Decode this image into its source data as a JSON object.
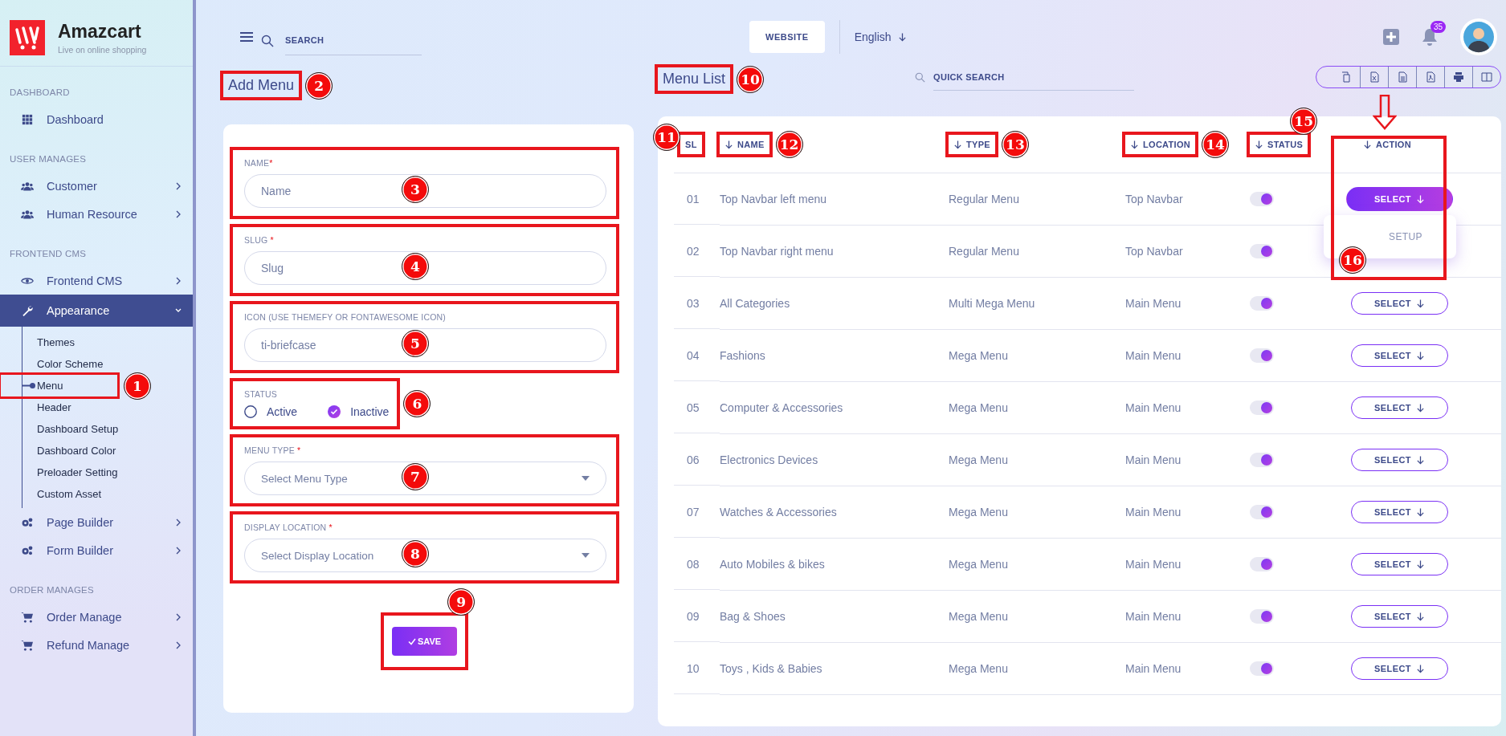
{
  "sidebar": {
    "brand": {
      "name": "Amazcart",
      "tagline": "Live on online shopping"
    },
    "sections": [
      {
        "title": "DASHBOARD",
        "items": [
          {
            "label": "Dashboard",
            "arrow": false,
            "selected": false
          }
        ]
      },
      {
        "title": "USER MANAGES",
        "items": [
          {
            "label": "Customer",
            "arrow": true,
            "expanded": false,
            "selected": false
          },
          {
            "label": "Human Resource",
            "arrow": true,
            "expanded": false,
            "selected": false
          }
        ]
      },
      {
        "title": "FRONTEND CMS",
        "items": [
          {
            "label": "Frontend CMS",
            "arrow": true,
            "expanded": false,
            "selected": false
          },
          {
            "label": "Appearance",
            "arrow": true,
            "expanded": true,
            "selected": true,
            "children": [
              {
                "label": "Themes",
                "selected": false
              },
              {
                "label": "Color Scheme",
                "selected": false
              },
              {
                "label": "Menu",
                "selected": true,
                "callout": "1"
              },
              {
                "label": "Header",
                "selected": false
              },
              {
                "label": "Dashboard Setup",
                "selected": false
              },
              {
                "label": "Dashboard Color",
                "selected": false
              },
              {
                "label": "Preloader Setting",
                "selected": false
              },
              {
                "label": "Custom Asset",
                "selected": false
              }
            ]
          },
          {
            "label": "Page Builder",
            "arrow": true,
            "expanded": false,
            "selected": false
          },
          {
            "label": "Form Builder",
            "arrow": true,
            "expanded": false,
            "selected": false
          }
        ]
      },
      {
        "title": "ORDER MANAGES",
        "items": [
          {
            "label": "Order Manage",
            "arrow": true,
            "expanded": false,
            "selected": false
          },
          {
            "label": "Refund Manage",
            "arrow": true,
            "expanded": false,
            "selected": false
          }
        ]
      }
    ]
  },
  "topbar": {
    "search": {
      "placeholder": "SEARCH"
    },
    "website_button": "WEBSITE",
    "language": "English",
    "notification_count": "35"
  },
  "add_menu": {
    "title": "Add Menu",
    "callout": "2",
    "fields": [
      {
        "kind": "text",
        "label": "NAME",
        "required_mark": "*",
        "placeholder": "Name",
        "callout": "3"
      },
      {
        "kind": "text",
        "label": "SLUG",
        "required_mark": " *",
        "placeholder": "Slug",
        "callout": "4"
      },
      {
        "kind": "text",
        "label": "ICON (USE THEMEFY OR FONTAWESOME ICON)",
        "placeholder": "ti-briefcase",
        "callout": "5"
      },
      {
        "kind": "radio",
        "label": "STATUS",
        "callout": "6",
        "options": [
          {
            "label": "Active",
            "selected": false
          },
          {
            "label": "Inactive",
            "selected": true
          }
        ]
      },
      {
        "kind": "select",
        "label": "MENU TYPE",
        "required_mark": " *",
        "placeholder": "Select Menu Type",
        "callout": "7"
      },
      {
        "kind": "select",
        "label": "DISPLAY LOCATION",
        "required_mark": " *",
        "placeholder": "Select Display Location",
        "callout": "8"
      }
    ],
    "save_button": "SAVE",
    "save_callout": "9"
  },
  "menu_list": {
    "title": "Menu List",
    "callout": "10",
    "quick_search": {
      "placeholder": "QUICK SEARCH"
    },
    "columns": [
      {
        "label": "SL",
        "sortable": false,
        "callout": "11"
      },
      {
        "label": "NAME",
        "sortable": true,
        "callout": "12"
      },
      {
        "label": "TYPE",
        "sortable": true,
        "callout": "13"
      },
      {
        "label": "LOCATION",
        "sortable": true,
        "callout": "14"
      },
      {
        "label": "STATUS",
        "sortable": true,
        "callout": "15"
      },
      {
        "label": "ACTION",
        "sortable": true
      }
    ],
    "action_callout": "16",
    "rows": [
      {
        "sl": "01",
        "name": "Top Navbar left menu",
        "type": "Regular Menu",
        "location": "Top Navbar",
        "on": true,
        "action": {
          "label": "SELECT",
          "open": true,
          "menu": [
            "SETUP"
          ]
        }
      },
      {
        "sl": "02",
        "name": "Top Navbar right menu",
        "type": "Regular Menu",
        "location": "Top Navbar",
        "on": true
      },
      {
        "sl": "03",
        "name": "All Categories",
        "type": "Multi Mega Menu",
        "location": "Main Menu",
        "on": true,
        "action": {
          "label": "SELECT",
          "open": false
        }
      },
      {
        "sl": "04",
        "name": "Fashions",
        "type": "Mega Menu",
        "location": "Main Menu",
        "on": true,
        "action": {
          "label": "SELECT",
          "open": false
        }
      },
      {
        "sl": "05",
        "name": "Computer & Accessories",
        "type": "Mega Menu",
        "location": "Main Menu",
        "on": true,
        "action": {
          "label": "SELECT",
          "open": false
        }
      },
      {
        "sl": "06",
        "name": "Electronics Devices",
        "type": "Mega Menu",
        "location": "Main Menu",
        "on": true,
        "action": {
          "label": "SELECT",
          "open": false
        }
      },
      {
        "sl": "07",
        "name": "Watches & Accessories",
        "type": "Mega Menu",
        "location": "Main Menu",
        "on": true,
        "action": {
          "label": "SELECT",
          "open": false
        }
      },
      {
        "sl": "08",
        "name": "Auto Mobiles & bikes",
        "type": "Mega Menu",
        "location": "Main Menu",
        "on": true,
        "action": {
          "label": "SELECT",
          "open": false
        }
      },
      {
        "sl": "09",
        "name": "Bag & Shoes",
        "type": "Mega Menu",
        "location": "Main Menu",
        "on": true,
        "action": {
          "label": "SELECT",
          "open": false
        }
      },
      {
        "sl": "10",
        "name": "Toys , Kids & Babies",
        "type": "Mega Menu",
        "location": "Main Menu",
        "on": true,
        "action": {
          "label": "SELECT",
          "open": false
        }
      }
    ]
  }
}
